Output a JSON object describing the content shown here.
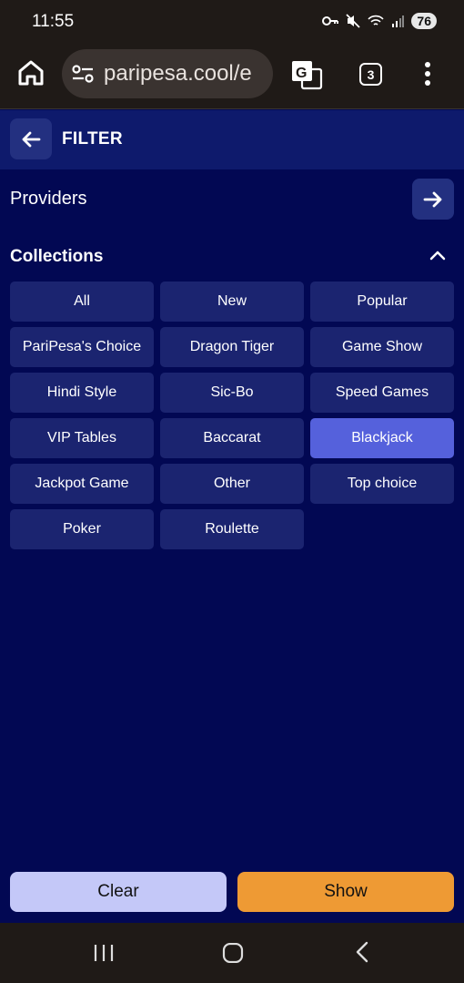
{
  "status_bar": {
    "time": "11:55",
    "battery": "76"
  },
  "browser": {
    "url": "paripesa.cool/e",
    "tab_count": "3"
  },
  "filter": {
    "title": "FILTER"
  },
  "providers": {
    "label": "Providers"
  },
  "collections": {
    "label": "Collections",
    "items": [
      {
        "label": "All"
      },
      {
        "label": "New"
      },
      {
        "label": "Popular"
      },
      {
        "label": "PariPesa's Choice"
      },
      {
        "label": "Dragon Tiger"
      },
      {
        "label": "Game Show"
      },
      {
        "label": "Hindi Style"
      },
      {
        "label": "Sic-Bo"
      },
      {
        "label": "Speed Games"
      },
      {
        "label": "VIP Tables"
      },
      {
        "label": "Baccarat"
      },
      {
        "label": "Blackjack"
      },
      {
        "label": "Jackpot Game"
      },
      {
        "label": "Other"
      },
      {
        "label": "Top choice"
      },
      {
        "label": "Poker"
      },
      {
        "label": "Roulette"
      }
    ],
    "selected": "Blackjack"
  },
  "actions": {
    "clear_label": "Clear",
    "show_label": "Show"
  },
  "colors": {
    "background": "#020853",
    "chip": "#1b2470",
    "chip_selected": "#5561dc",
    "show_button": "#ee9a34",
    "clear_button": "#c4c8f8"
  }
}
